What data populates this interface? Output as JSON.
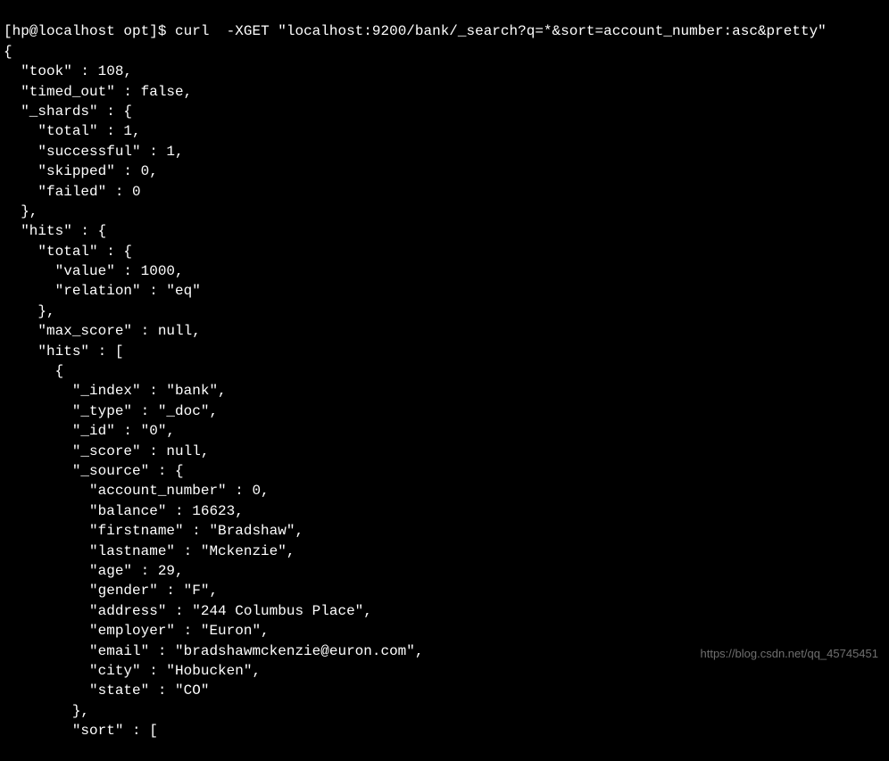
{
  "prompt": {
    "user_host": "[hp@localhost opt]$",
    "command": "curl  -XGET \"localhost:9200/bank/_search?q=*&sort=account_number:asc&pretty\""
  },
  "output": {
    "lines": [
      "{",
      "  \"took\" : 108,",
      "  \"timed_out\" : false,",
      "  \"_shards\" : {",
      "    \"total\" : 1,",
      "    \"successful\" : 1,",
      "    \"skipped\" : 0,",
      "    \"failed\" : 0",
      "  },",
      "  \"hits\" : {",
      "    \"total\" : {",
      "      \"value\" : 1000,",
      "      \"relation\" : \"eq\"",
      "    },",
      "    \"max_score\" : null,",
      "    \"hits\" : [",
      "      {",
      "        \"_index\" : \"bank\",",
      "        \"_type\" : \"_doc\",",
      "        \"_id\" : \"0\",",
      "        \"_score\" : null,",
      "        \"_source\" : {",
      "          \"account_number\" : 0,",
      "          \"balance\" : 16623,",
      "          \"firstname\" : \"Bradshaw\",",
      "          \"lastname\" : \"Mckenzie\",",
      "          \"age\" : 29,",
      "          \"gender\" : \"F\",",
      "          \"address\" : \"244 Columbus Place\",",
      "          \"employer\" : \"Euron\",",
      "          \"email\" : \"bradshawmckenzie@euron.com\",",
      "          \"city\" : \"Hobucken\",",
      "          \"state\" : \"CO\"",
      "        },",
      "        \"sort\" : ["
    ]
  },
  "response_data": {
    "took": 108,
    "timed_out": false,
    "_shards": {
      "total": 1,
      "successful": 1,
      "skipped": 0,
      "failed": 0
    },
    "hits": {
      "total": {
        "value": 1000,
        "relation": "eq"
      },
      "max_score": null,
      "hits": [
        {
          "_index": "bank",
          "_type": "_doc",
          "_id": "0",
          "_score": null,
          "_source": {
            "account_number": 0,
            "balance": 16623,
            "firstname": "Bradshaw",
            "lastname": "Mckenzie",
            "age": 29,
            "gender": "F",
            "address": "244 Columbus Place",
            "employer": "Euron",
            "email": "bradshawmckenzie@euron.com",
            "city": "Hobucken",
            "state": "CO"
          }
        }
      ]
    }
  },
  "watermark": "https://blog.csdn.net/qq_45745451"
}
